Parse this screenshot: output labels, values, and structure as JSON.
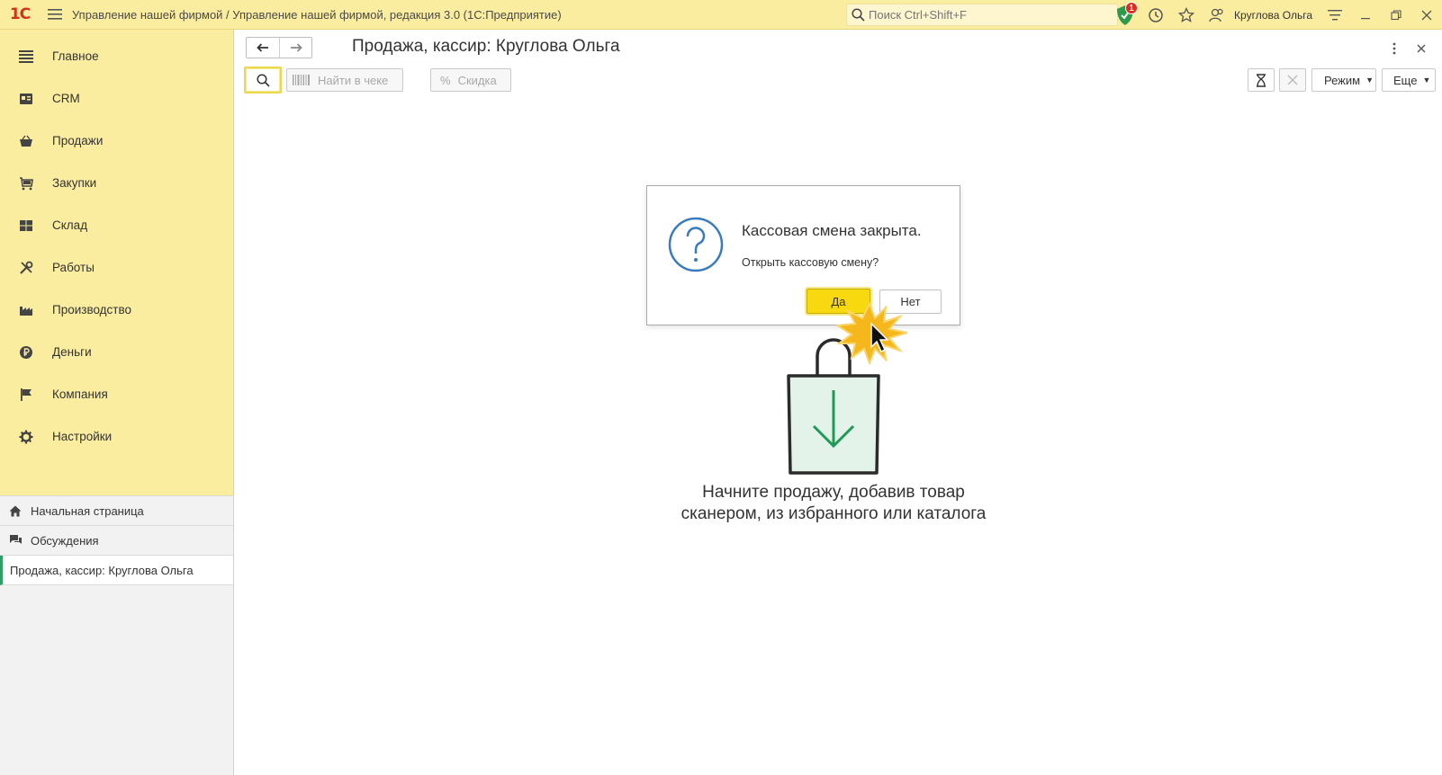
{
  "titlebar": {
    "logo": "1С",
    "app_title": "Управление нашей фирмой / Управление нашей фирмой, редакция 3.0  (1С:Предприятие)",
    "search_placeholder": "Поиск Ctrl+Shift+F",
    "notification_count": "1",
    "user_name": "Круглова Ольга"
  },
  "sidebar": {
    "sections": [
      {
        "label": "Главное",
        "icon": "menu-lines-icon"
      },
      {
        "label": "CRM",
        "icon": "crm-icon"
      },
      {
        "label": "Продажи",
        "icon": "basket-icon"
      },
      {
        "label": "Закупки",
        "icon": "cart-icon"
      },
      {
        "label": "Склад",
        "icon": "warehouse-icon"
      },
      {
        "label": "Работы",
        "icon": "tools-icon"
      },
      {
        "label": "Производство",
        "icon": "factory-icon"
      },
      {
        "label": "Деньги",
        "icon": "ruble-icon"
      },
      {
        "label": "Компания",
        "icon": "flag-icon"
      },
      {
        "label": "Настройки",
        "icon": "gear-icon"
      }
    ],
    "open_windows": [
      {
        "label": "Начальная страница",
        "icon": "home-icon"
      },
      {
        "label": "Обсуждения",
        "icon": "discussion-icon"
      },
      {
        "label": "Продажа, кассир: Круглова Ольга",
        "active": true
      }
    ]
  },
  "document": {
    "title": "Продажа, кассир: Круглова Ольга",
    "toolbar": {
      "find_in_receipt": "Найти в чеке",
      "discount": "Скидка",
      "mode": "Режим",
      "more": "Еще"
    },
    "hint_line1": "Начните продажу, добавив товар",
    "hint_line2": "сканером, из избранного или каталога"
  },
  "dialog": {
    "title": "Кассовая смена закрыта.",
    "message": "Открыть кассовую смену?",
    "yes": "Да",
    "no": "Нет"
  },
  "colors": {
    "accent_yellow": "#fbeda0",
    "button_yellow": "#f8d80f",
    "brand_red": "#d4311a",
    "active_green": "#2e9e62",
    "dialog_icon_blue": "#3a7bbf"
  }
}
